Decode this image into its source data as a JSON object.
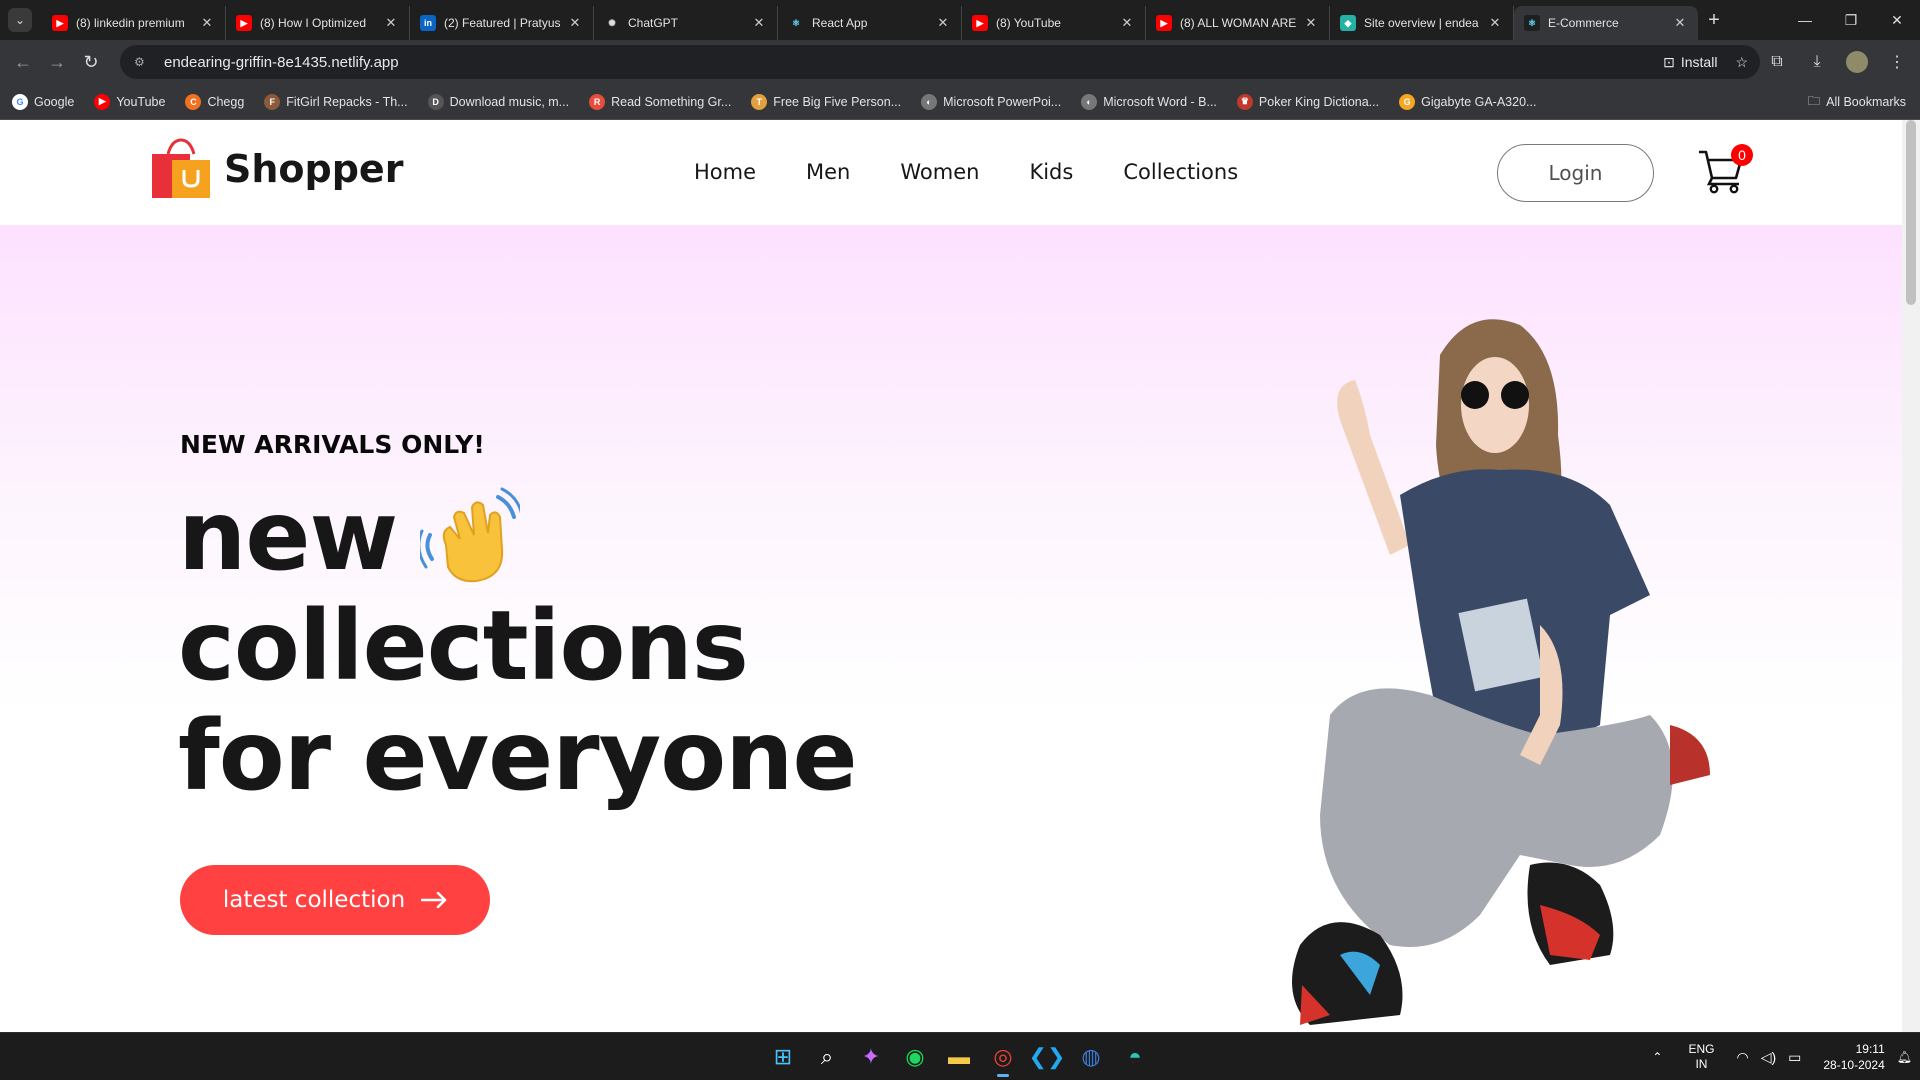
{
  "browser": {
    "tabs": [
      {
        "title": "(8) linkedin premium",
        "icon": "youtube-icon",
        "active": false
      },
      {
        "title": "(8) How I Optimized",
        "icon": "youtube-icon",
        "active": false
      },
      {
        "title": "(2) Featured | Pratyus",
        "icon": "linkedin-icon",
        "active": false
      },
      {
        "title": "ChatGPT",
        "icon": "chatgpt-icon",
        "active": false
      },
      {
        "title": "React App",
        "icon": "react-icon",
        "active": false
      },
      {
        "title": "(8) YouTube",
        "icon": "youtube-icon",
        "active": false
      },
      {
        "title": "(8) ALL WOMAN ARE",
        "icon": "youtube-icon",
        "active": false
      },
      {
        "title": "Site overview | endea",
        "icon": "netlify-icon",
        "active": false
      },
      {
        "title": "E-Commerce",
        "icon": "react-icon",
        "active": true
      }
    ],
    "url": "endearing-griffin-8e1435.netlify.app",
    "install_label": "Install",
    "bookmarks": [
      {
        "label": "Google",
        "color": "#ffffff",
        "glyph": "G"
      },
      {
        "label": "YouTube",
        "color": "#ff0000",
        "glyph": "▶"
      },
      {
        "label": "Chegg",
        "color": "#f27121",
        "glyph": "C"
      },
      {
        "label": "FitGirl Repacks - Th...",
        "color": "#8a5a3a",
        "glyph": "F"
      },
      {
        "label": "Download music, m...",
        "color": "#555555",
        "glyph": "D"
      },
      {
        "label": "Read Something Gr...",
        "color": "#e74c3c",
        "glyph": "R"
      },
      {
        "label": "Free Big Five Person...",
        "color": "#e2a03f",
        "glyph": "T"
      },
      {
        "label": "Microsoft PowerPoi...",
        "color": "#777777",
        "glyph": "◐"
      },
      {
        "label": "Microsoft Word - B...",
        "color": "#777777",
        "glyph": "◐"
      },
      {
        "label": "Poker King Dictiona...",
        "color": "#c0392b",
        "glyph": "♛"
      },
      {
        "label": "Gigabyte GA-A320...",
        "color": "#f5a623",
        "glyph": "G"
      }
    ],
    "all_bookmarks_label": "All Bookmarks"
  },
  "site": {
    "logo_text": "Shopper",
    "nav": [
      "Home",
      "Men",
      "Women",
      "Kids",
      "Collections"
    ],
    "login_label": "Login",
    "cart_count": "0",
    "hero": {
      "kicker": "NEW ARRIVALS ONLY!",
      "line1": "new",
      "line2": "collections",
      "line3": "for everyone",
      "cta": "latest collection"
    },
    "accent": "#ff4141"
  },
  "taskbar": {
    "apps": [
      "windows-start-icon",
      "search-icon",
      "copilot-icon",
      "spotify-icon",
      "file-explorer-icon",
      "chrome-icon",
      "vscode-icon",
      "firefox-icon",
      "edge-icon"
    ],
    "lang_line1": "ENG",
    "lang_line2": "IN",
    "time": "19:11",
    "date": "28-10-2024"
  }
}
